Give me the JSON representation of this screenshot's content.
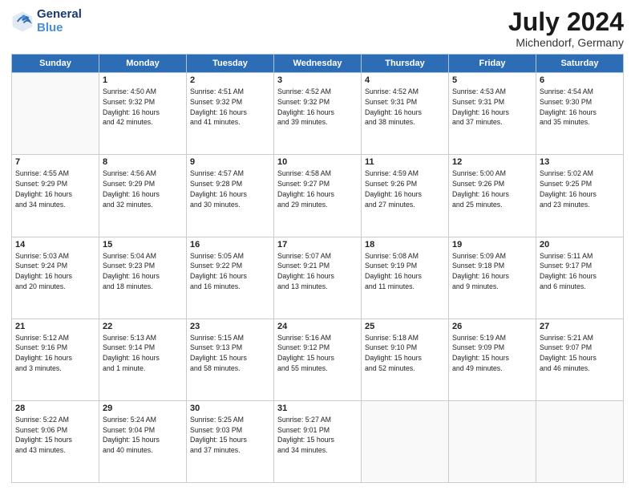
{
  "logo": {
    "line1": "General",
    "line2": "Blue"
  },
  "title": "July 2024",
  "location": "Michendorf, Germany",
  "weekdays": [
    "Sunday",
    "Monday",
    "Tuesday",
    "Wednesday",
    "Thursday",
    "Friday",
    "Saturday"
  ],
  "weeks": [
    [
      {
        "day": null,
        "info": null
      },
      {
        "day": "1",
        "info": "Sunrise: 4:50 AM\nSunset: 9:32 PM\nDaylight: 16 hours\nand 42 minutes."
      },
      {
        "day": "2",
        "info": "Sunrise: 4:51 AM\nSunset: 9:32 PM\nDaylight: 16 hours\nand 41 minutes."
      },
      {
        "day": "3",
        "info": "Sunrise: 4:52 AM\nSunset: 9:32 PM\nDaylight: 16 hours\nand 39 minutes."
      },
      {
        "day": "4",
        "info": "Sunrise: 4:52 AM\nSunset: 9:31 PM\nDaylight: 16 hours\nand 38 minutes."
      },
      {
        "day": "5",
        "info": "Sunrise: 4:53 AM\nSunset: 9:31 PM\nDaylight: 16 hours\nand 37 minutes."
      },
      {
        "day": "6",
        "info": "Sunrise: 4:54 AM\nSunset: 9:30 PM\nDaylight: 16 hours\nand 35 minutes."
      }
    ],
    [
      {
        "day": "7",
        "info": "Sunrise: 4:55 AM\nSunset: 9:29 PM\nDaylight: 16 hours\nand 34 minutes."
      },
      {
        "day": "8",
        "info": "Sunrise: 4:56 AM\nSunset: 9:29 PM\nDaylight: 16 hours\nand 32 minutes."
      },
      {
        "day": "9",
        "info": "Sunrise: 4:57 AM\nSunset: 9:28 PM\nDaylight: 16 hours\nand 30 minutes."
      },
      {
        "day": "10",
        "info": "Sunrise: 4:58 AM\nSunset: 9:27 PM\nDaylight: 16 hours\nand 29 minutes."
      },
      {
        "day": "11",
        "info": "Sunrise: 4:59 AM\nSunset: 9:26 PM\nDaylight: 16 hours\nand 27 minutes."
      },
      {
        "day": "12",
        "info": "Sunrise: 5:00 AM\nSunset: 9:26 PM\nDaylight: 16 hours\nand 25 minutes."
      },
      {
        "day": "13",
        "info": "Sunrise: 5:02 AM\nSunset: 9:25 PM\nDaylight: 16 hours\nand 23 minutes."
      }
    ],
    [
      {
        "day": "14",
        "info": "Sunrise: 5:03 AM\nSunset: 9:24 PM\nDaylight: 16 hours\nand 20 minutes."
      },
      {
        "day": "15",
        "info": "Sunrise: 5:04 AM\nSunset: 9:23 PM\nDaylight: 16 hours\nand 18 minutes."
      },
      {
        "day": "16",
        "info": "Sunrise: 5:05 AM\nSunset: 9:22 PM\nDaylight: 16 hours\nand 16 minutes."
      },
      {
        "day": "17",
        "info": "Sunrise: 5:07 AM\nSunset: 9:21 PM\nDaylight: 16 hours\nand 13 minutes."
      },
      {
        "day": "18",
        "info": "Sunrise: 5:08 AM\nSunset: 9:19 PM\nDaylight: 16 hours\nand 11 minutes."
      },
      {
        "day": "19",
        "info": "Sunrise: 5:09 AM\nSunset: 9:18 PM\nDaylight: 16 hours\nand 9 minutes."
      },
      {
        "day": "20",
        "info": "Sunrise: 5:11 AM\nSunset: 9:17 PM\nDaylight: 16 hours\nand 6 minutes."
      }
    ],
    [
      {
        "day": "21",
        "info": "Sunrise: 5:12 AM\nSunset: 9:16 PM\nDaylight: 16 hours\nand 3 minutes."
      },
      {
        "day": "22",
        "info": "Sunrise: 5:13 AM\nSunset: 9:14 PM\nDaylight: 16 hours\nand 1 minute."
      },
      {
        "day": "23",
        "info": "Sunrise: 5:15 AM\nSunset: 9:13 PM\nDaylight: 15 hours\nand 58 minutes."
      },
      {
        "day": "24",
        "info": "Sunrise: 5:16 AM\nSunset: 9:12 PM\nDaylight: 15 hours\nand 55 minutes."
      },
      {
        "day": "25",
        "info": "Sunrise: 5:18 AM\nSunset: 9:10 PM\nDaylight: 15 hours\nand 52 minutes."
      },
      {
        "day": "26",
        "info": "Sunrise: 5:19 AM\nSunset: 9:09 PM\nDaylight: 15 hours\nand 49 minutes."
      },
      {
        "day": "27",
        "info": "Sunrise: 5:21 AM\nSunset: 9:07 PM\nDaylight: 15 hours\nand 46 minutes."
      }
    ],
    [
      {
        "day": "28",
        "info": "Sunrise: 5:22 AM\nSunset: 9:06 PM\nDaylight: 15 hours\nand 43 minutes."
      },
      {
        "day": "29",
        "info": "Sunrise: 5:24 AM\nSunset: 9:04 PM\nDaylight: 15 hours\nand 40 minutes."
      },
      {
        "day": "30",
        "info": "Sunrise: 5:25 AM\nSunset: 9:03 PM\nDaylight: 15 hours\nand 37 minutes."
      },
      {
        "day": "31",
        "info": "Sunrise: 5:27 AM\nSunset: 9:01 PM\nDaylight: 15 hours\nand 34 minutes."
      },
      {
        "day": null,
        "info": null
      },
      {
        "day": null,
        "info": null
      },
      {
        "day": null,
        "info": null
      }
    ]
  ]
}
